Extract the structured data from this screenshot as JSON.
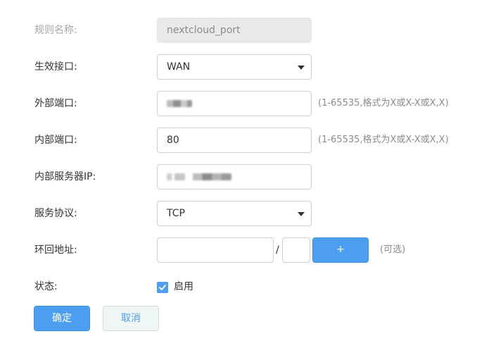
{
  "form": {
    "rule_name": {
      "label": "规则名称:",
      "value": "nextcloud_port"
    },
    "interface": {
      "label": "生效接口:",
      "value": "WAN"
    },
    "external_port": {
      "label": "外部端口:",
      "hint": "(1-65535,格式为X或X-X或X,X)"
    },
    "internal_port": {
      "label": "内部端口:",
      "value": "80",
      "hint": "(1-65535,格式为X或X-X或X,X)"
    },
    "internal_ip": {
      "label": "内部服务器IP:"
    },
    "protocol": {
      "label": "服务协议:",
      "value": "TCP"
    },
    "loopback": {
      "label": "环回地址:",
      "separator": "/",
      "add_label": "+",
      "optional": "(可选)"
    },
    "status": {
      "label": "状态:",
      "checkbox_label": "启用",
      "checked": true
    }
  },
  "actions": {
    "confirm": "确定",
    "cancel": "取消"
  },
  "colors": {
    "accent": "#4c9ef1",
    "disabled_bg": "#e9e9e9",
    "hint_text": "#8c8c8c"
  }
}
